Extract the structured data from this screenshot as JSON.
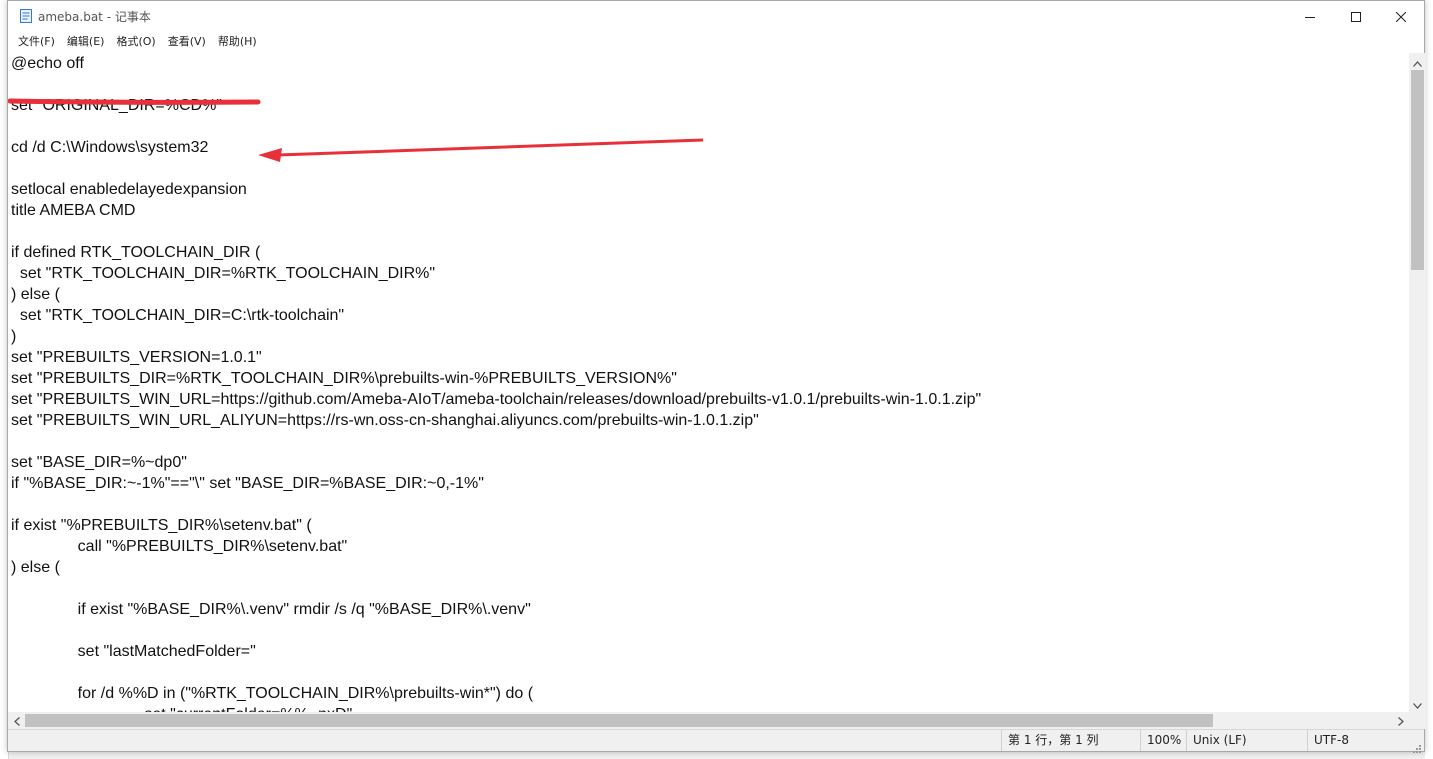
{
  "window": {
    "title": "ameba.bat - 记事本",
    "controls": {
      "minimize": "minimize-icon",
      "maximize": "maximize-icon",
      "close": "close-icon"
    }
  },
  "menu": [
    {
      "label": "文件(F)"
    },
    {
      "label": "编辑(E)"
    },
    {
      "label": "格式(O)"
    },
    {
      "label": "查看(V)"
    },
    {
      "label": "帮助(H)"
    }
  ],
  "editor": {
    "lines": [
      "@echo off",
      "",
      "set \"ORIGINAL_DIR=%CD%\"",
      "",
      "cd /d C:\\Windows\\system32",
      "",
      "setlocal enabledelayedexpansion",
      "title AMEBA CMD",
      "",
      "if defined RTK_TOOLCHAIN_DIR (",
      "  set \"RTK_TOOLCHAIN_DIR=%RTK_TOOLCHAIN_DIR%\"",
      ") else (",
      "  set \"RTK_TOOLCHAIN_DIR=C:\\rtk-toolchain\"",
      ")",
      "set \"PREBUILTS_VERSION=1.0.1\"",
      "set \"PREBUILTS_DIR=%RTK_TOOLCHAIN_DIR%\\prebuilts-win-%PREBUILTS_VERSION%\"",
      "set \"PREBUILTS_WIN_URL=https://github.com/Ameba-AIoT/ameba-toolchain/releases/download/prebuilts-v1.0.1/prebuilts-win-1.0.1.zip\"",
      "set \"PREBUILTS_WIN_URL_ALIYUN=https://rs-wn.oss-cn-shanghai.aliyuncs.com/prebuilts-win-1.0.1.zip\"",
      "",
      "set \"BASE_DIR=%~dp0\"",
      "if \"%BASE_DIR:~-1%\"==\"\\\" set \"BASE_DIR=%BASE_DIR:~0,-1%\"",
      "",
      "if exist \"%PREBUILTS_DIR%\\setenv.bat\" (",
      "               call \"%PREBUILTS_DIR%\\setenv.bat\"",
      ") else (",
      "",
      "               if exist \"%BASE_DIR%\\.venv\" rmdir /s /q \"%BASE_DIR%\\.venv\"",
      "",
      "               set \"lastMatchedFolder=\"",
      "",
      "               for /d %%D in (\"%RTK_TOOLCHAIN_DIR%\\prebuilts-win*\") do (",
      "                              set \"currentFolder=%%~nxD\""
    ],
    "annotation_color": "#e8303a"
  },
  "status": {
    "position": "第 1 行，第 1 列",
    "zoom": "100%",
    "line_ending": "Unix (LF)",
    "encoding": "UTF-8"
  }
}
